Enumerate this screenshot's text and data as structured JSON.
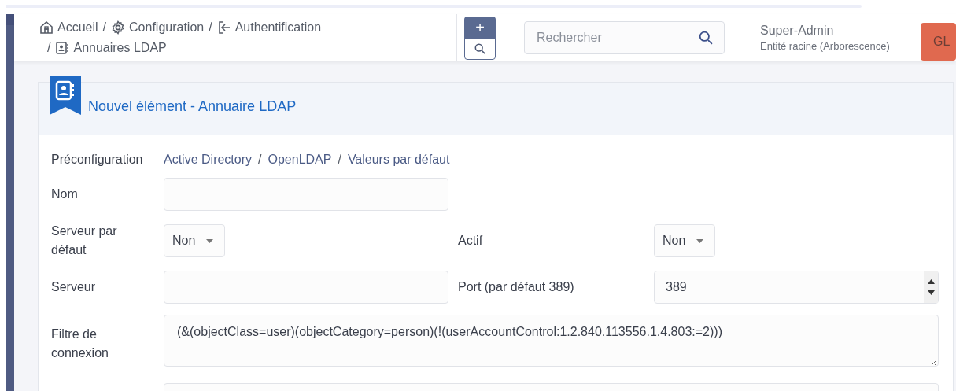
{
  "breadcrumb": [
    {
      "kind": "home",
      "label": "Accueil"
    },
    {
      "separator": "/",
      "kind": "gear",
      "label": "Configuration"
    },
    {
      "separator": "/",
      "kind": "login",
      "label": "Authentification"
    },
    {
      "separator": "/",
      "kind": "contact",
      "label": "Annuaires LDAP"
    }
  ],
  "header": {
    "add_button": "+",
    "search": {
      "placeholder": "Rechercher"
    },
    "user": {
      "name": "Super-Admin",
      "entity": "Entité racine (Arborescence)",
      "initials": "GL"
    }
  },
  "card": {
    "title": "Nouvel élément - Annuaire LDAP",
    "preconfiguration": {
      "label": "Préconfiguration",
      "links": [
        {
          "label": "Active Directory"
        },
        {
          "separator": "/",
          "label": "OpenLDAP"
        },
        {
          "separator": "/",
          "label": "Valeurs par défaut"
        }
      ]
    },
    "rows": [
      {
        "fields": [
          {
            "kind": "text",
            "label": "Nom"
          }
        ]
      },
      {
        "fields": [
          {
            "kind": "select",
            "label": "Serveur par défaut",
            "value": "Non"
          },
          {
            "kind": "select",
            "label": "Actif",
            "value": "Non"
          }
        ]
      },
      {
        "fields": [
          {
            "kind": "text",
            "label": "Serveur"
          },
          {
            "kind": "number",
            "label": "Port (par défaut 389)",
            "value": "389"
          }
        ]
      },
      {
        "fields": [
          {
            "kind": "textarea",
            "label": "Filtre de connexion",
            "value": "(&(objectClass=user)(objectCategory=person)(!(userAccountControl:1.2.840.113556.1.4.803:=2)))"
          }
        ]
      },
      {
        "fields": [
          {
            "kind": "wide"
          }
        ]
      }
    ]
  }
}
